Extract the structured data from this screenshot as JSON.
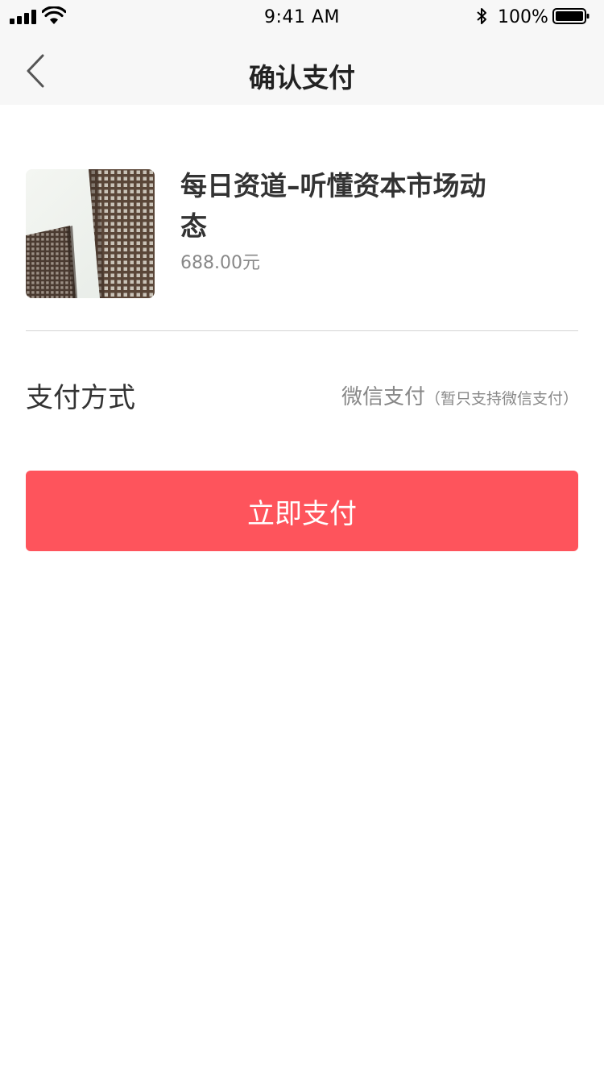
{
  "status_bar": {
    "time": "9:41 AM",
    "battery_percent": "100%"
  },
  "nav": {
    "title": "确认支付",
    "back_icon": "chevron-left-icon"
  },
  "product": {
    "title": "每日资道–听懂资本市场动态",
    "price": "688.00元"
  },
  "payment": {
    "label": "支付方式",
    "method": "微信支付",
    "note": "（暂只支持微信支付）"
  },
  "actions": {
    "pay_now": "立即支付"
  },
  "colors": {
    "accent": "#fe545c",
    "nav_bg": "#f7f7f7"
  }
}
